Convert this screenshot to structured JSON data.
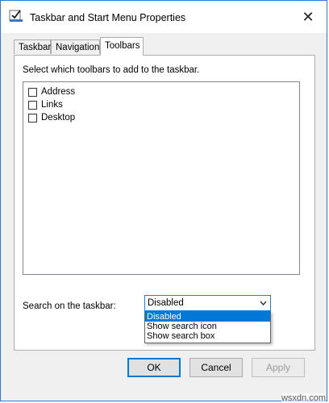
{
  "window": {
    "title": "Taskbar and Start Menu Properties",
    "close_glyph": "✕"
  },
  "tabs": [
    {
      "label": "Taskbar"
    },
    {
      "label": "Navigation"
    },
    {
      "label": "Toolbars",
      "active": true
    }
  ],
  "toolbars": {
    "instruction": "Select which toolbars to add to the taskbar.",
    "items": [
      {
        "label": "Address",
        "checked": false
      },
      {
        "label": "Links",
        "checked": false
      },
      {
        "label": "Desktop",
        "checked": false
      }
    ]
  },
  "search": {
    "label": "Search on the taskbar:",
    "selected": "Disabled",
    "options": [
      "Disabled",
      "Show search icon",
      "Show search box"
    ]
  },
  "buttons": {
    "ok": "OK",
    "cancel": "Cancel",
    "apply": "Apply"
  },
  "watermark": "wsxdn.com",
  "colors": {
    "accent": "#0078d7",
    "window_border": "#2b79d0"
  }
}
